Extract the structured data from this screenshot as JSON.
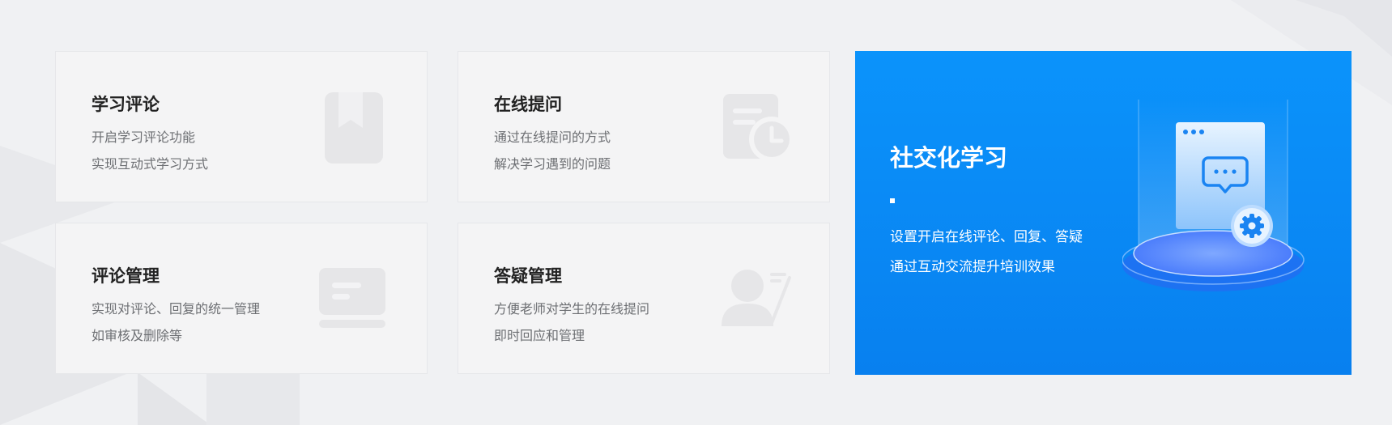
{
  "cards": [
    {
      "title": "学习评论",
      "lines": [
        "开启学习评论功能",
        "实现互动式学习方式"
      ],
      "icon": "bookmark-icon"
    },
    {
      "title": "在线提问",
      "lines": [
        "通过在线提问的方式",
        "解决学习遇到的问题"
      ],
      "icon": "document-clock-icon"
    },
    {
      "title": "评论管理",
      "lines": [
        "实现对评论、回复的统一管理",
        "如审核及删除等"
      ],
      "icon": "comment-list-icon"
    },
    {
      "title": "答疑管理",
      "lines": [
        "方便老师对学生的在线提问",
        "即时回应和管理"
      ],
      "icon": "user-edit-icon"
    }
  ],
  "feature": {
    "title": "社交化学习",
    "lines": [
      "设置开启在线评论、回复、答疑",
      "通过互动交流提升培训效果"
    ],
    "icon": "chat-settings-illustration",
    "colors": {
      "background": "#0b93fb",
      "text": "#ffffff"
    }
  },
  "colors": {
    "page_bg": "#f0f1f3",
    "card_bg": "#f4f4f5",
    "title": "#222222",
    "body": "#6d6f73",
    "accent": "#0a8cf7"
  }
}
